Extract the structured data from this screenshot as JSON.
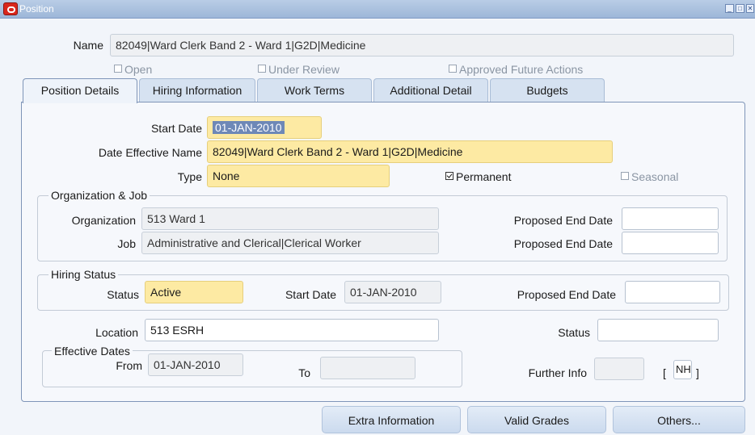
{
  "window": {
    "title": "Position",
    "minimize_glyph": "_",
    "maximize_glyph": "□",
    "close_glyph": "✕",
    "icon": "oracle-logo-icon"
  },
  "header": {
    "name_label": "Name",
    "name_value": "82049|Ward Clerk Band 2 - Ward 1|G2D|Medicine",
    "open": {
      "label": "Open",
      "checked": false
    },
    "under_review": {
      "label": "Under Review",
      "checked": false
    },
    "approved_future_actions": {
      "label": "Approved Future Actions",
      "checked": false
    }
  },
  "tabs": [
    {
      "label": "Position Details",
      "active": true
    },
    {
      "label": "Hiring Information",
      "active": false
    },
    {
      "label": "Work Terms",
      "active": false
    },
    {
      "label": "Additional Detail",
      "active": false
    },
    {
      "label": "Budgets",
      "active": false
    }
  ],
  "details": {
    "start_date_label": "Start Date",
    "start_date": "01-JAN-2010",
    "date_effective_name_label": "Date Effective Name",
    "date_effective_name": "82049|Ward Clerk Band 2 - Ward 1|G2D|Medicine",
    "type_label": "Type",
    "type": "None",
    "permanent": {
      "label": "Permanent",
      "checked": true
    },
    "seasonal": {
      "label": "Seasonal",
      "checked": false
    }
  },
  "org_job": {
    "title": "Organization & Job",
    "organization_label": "Organization",
    "organization": "513 Ward 1",
    "job_label": "Job",
    "job": "Administrative and Clerical|Clerical Worker",
    "proposed_end_date_label_1": "Proposed End Date",
    "proposed_end_date_1": "",
    "proposed_end_date_label_2": "Proposed End Date",
    "proposed_end_date_2": ""
  },
  "hiring_status": {
    "title": "Hiring Status",
    "status_label": "Status",
    "status": "Active",
    "start_date_label": "Start Date",
    "start_date": "01-JAN-2010",
    "proposed_end_date_label": "Proposed End Date",
    "proposed_end_date": ""
  },
  "location": {
    "label": "Location",
    "value": "513 ESRH",
    "status_label": "Status",
    "status": ""
  },
  "effective_dates": {
    "title": "Effective Dates",
    "from_label": "From",
    "from": "01-JAN-2010",
    "to_label": "To",
    "to": ""
  },
  "further_info": {
    "label": "Further Info",
    "value": "",
    "bracket_open": "[",
    "bracket_value": "NH",
    "bracket_close": "]"
  },
  "buttons": {
    "extra_information": "Extra Information",
    "valid_grades": "Valid Grades",
    "others": "Others..."
  },
  "colors": {
    "required_field": "#fdeaa3",
    "titlebar": "#9db6d8",
    "tab_active": "#eef3fa"
  }
}
